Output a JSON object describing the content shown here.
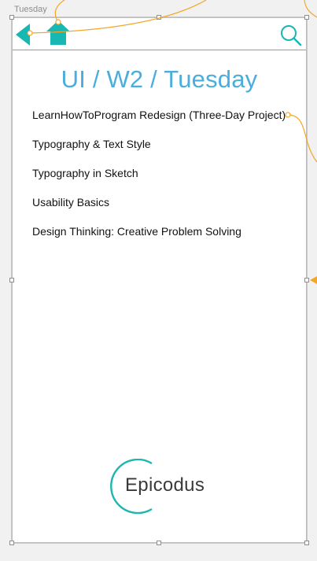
{
  "artboard": {
    "label": "Tuesday"
  },
  "header": {
    "back_icon": "back-arrow-icon",
    "home_icon": "home-icon",
    "search_icon": "search-icon",
    "accent_color": "#17b7b3"
  },
  "page": {
    "title": "UI / W2 / Tuesday",
    "title_color": "#4aaedc"
  },
  "lessons": [
    {
      "label": "LearnHowToProgram Redesign (Three-Day Project)"
    },
    {
      "label": "Typography & Text Style"
    },
    {
      "label": "Typography in Sketch"
    },
    {
      "label": "Usability Basics"
    },
    {
      "label": "Design Thinking: Creative Problem Solving"
    }
  ],
  "logo": {
    "text": "Epicodus",
    "ring_color": "#20b5b0"
  },
  "prototype_link_color": "#f5a623"
}
